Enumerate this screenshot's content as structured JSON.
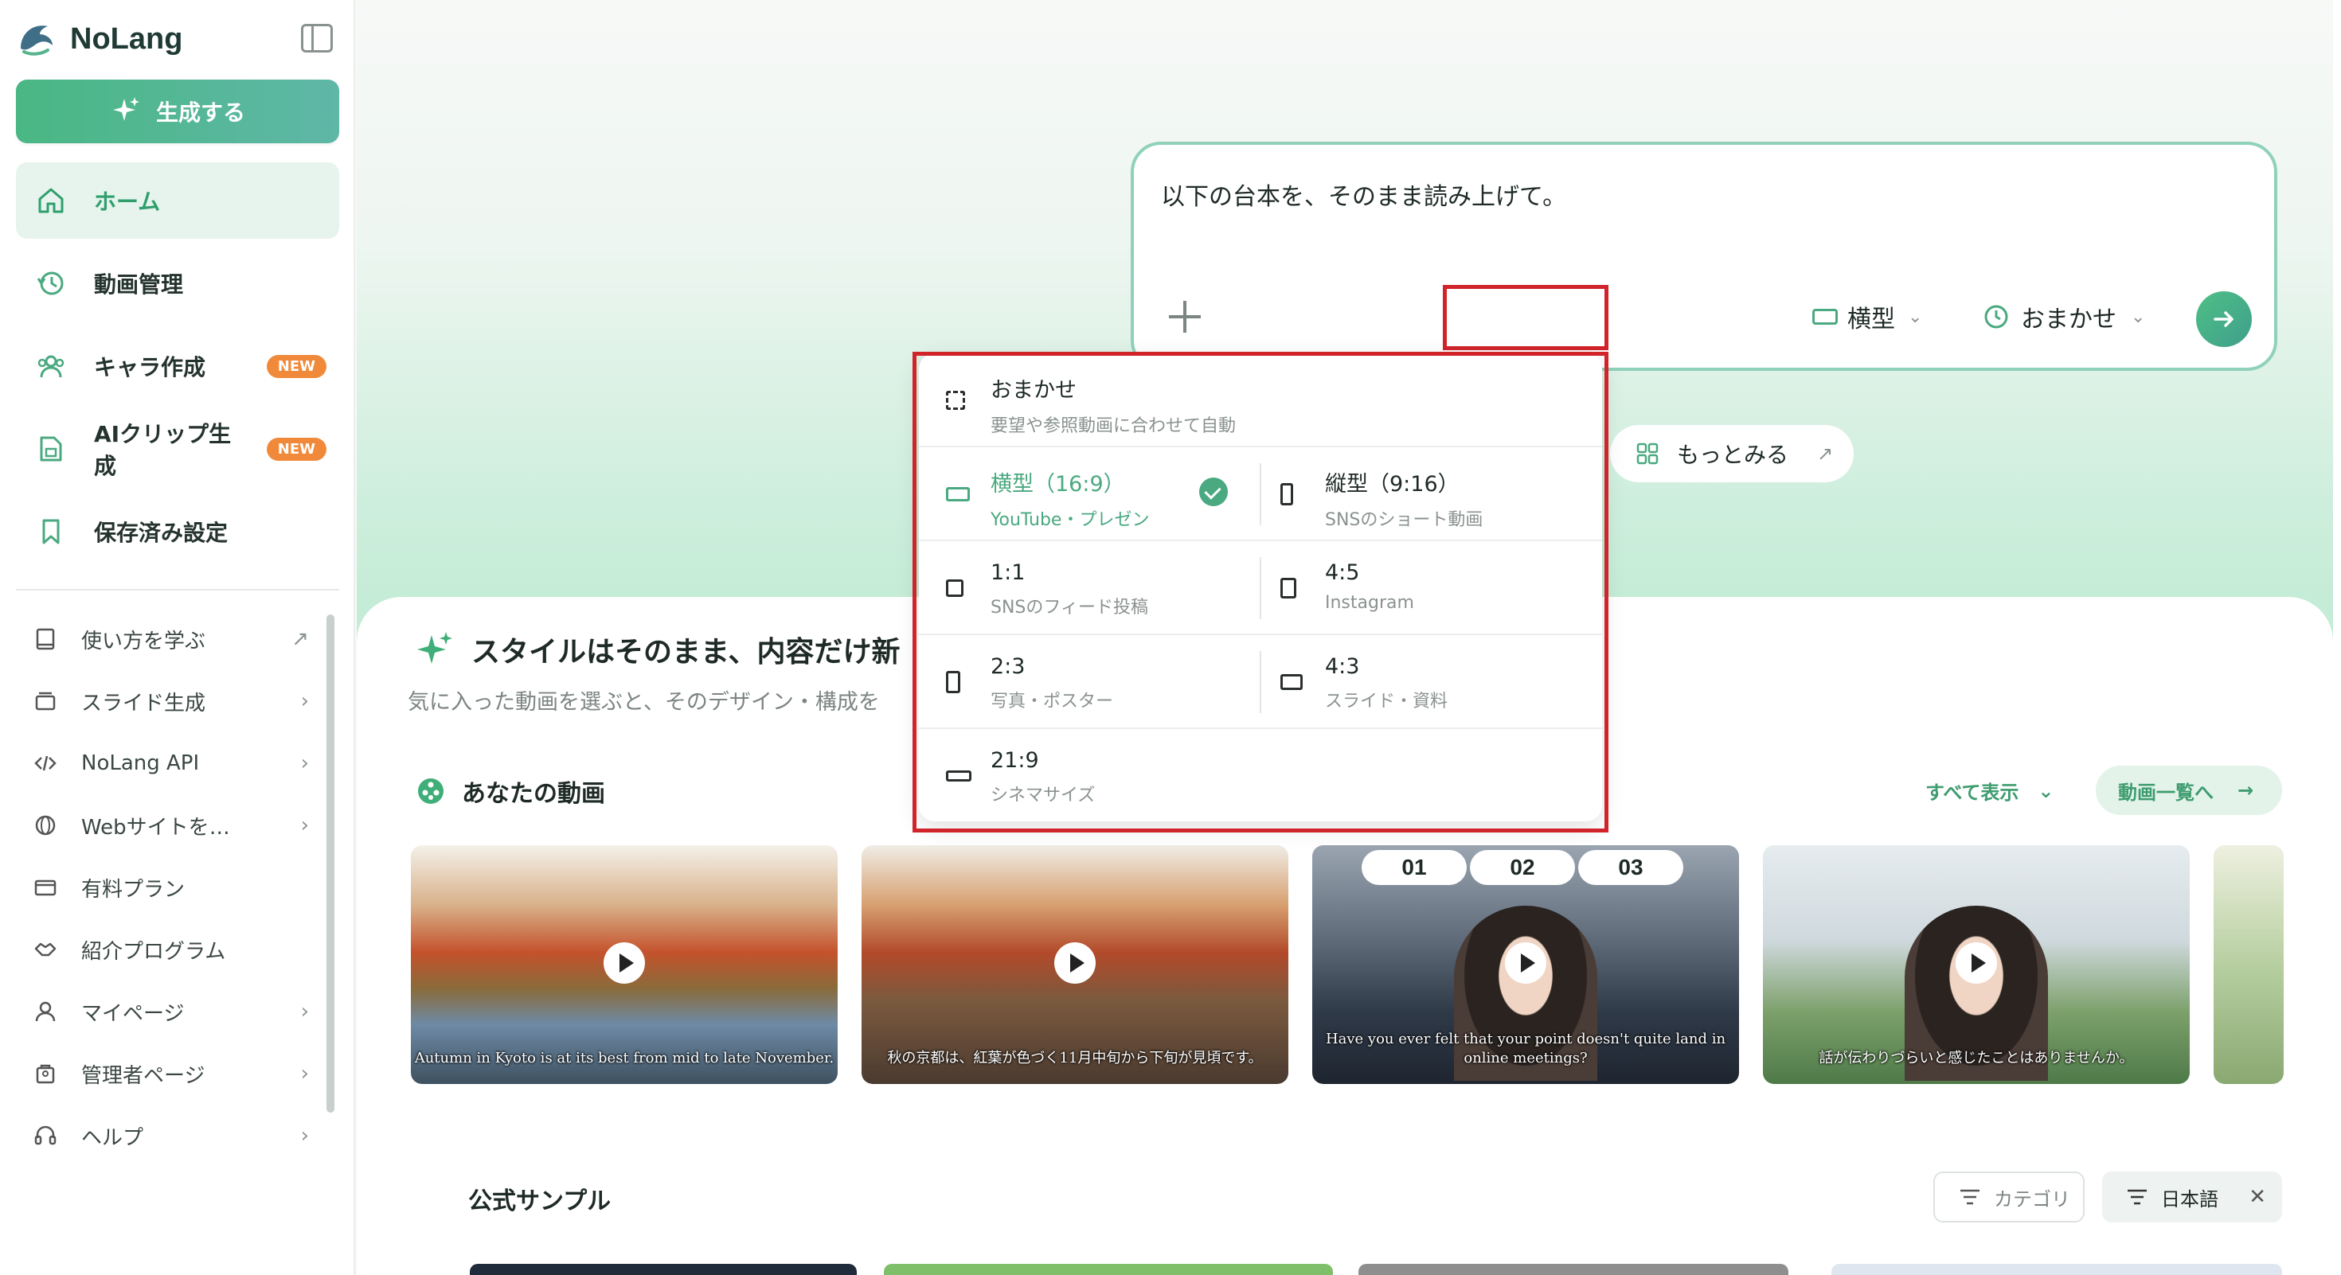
{
  "app": {
    "name": "NoLang"
  },
  "sidebar": {
    "generate_label": "生成する",
    "nav": [
      {
        "label": "ホーム",
        "icon": "home-icon",
        "active": true
      },
      {
        "label": "動画管理",
        "icon": "history-icon"
      },
      {
        "label": "キャラ作成",
        "icon": "users-icon",
        "badge": "NEW"
      },
      {
        "label": "AIクリップ生成",
        "icon": "clip-icon",
        "badge": "NEW"
      },
      {
        "label": "保存済み設定",
        "icon": "bookmark-icon"
      }
    ],
    "sub_nav": [
      {
        "label": "使い方を学ぶ",
        "icon": "book-icon",
        "tail": "↗"
      },
      {
        "label": "スライド生成",
        "icon": "slides-icon",
        "tail": "›"
      },
      {
        "label": "NoLang API",
        "icon": "code-icon",
        "tail": "›"
      },
      {
        "label": "Webサイトを動画にする",
        "icon": "web-icon",
        "tail": "›"
      },
      {
        "label": "有料プラン",
        "icon": "card-icon",
        "tail": ""
      },
      {
        "label": "紹介プログラム",
        "icon": "handshake-icon",
        "tail": ""
      },
      {
        "label": "マイページ",
        "icon": "user-icon",
        "tail": "›"
      },
      {
        "label": "管理者ページ",
        "icon": "admin-icon",
        "tail": "›"
      },
      {
        "label": "ヘルプ",
        "icon": "headset-icon",
        "tail": "›"
      }
    ]
  },
  "prompt": {
    "text": "以下の台本を、そのまま読み上げて。",
    "ratio_label": "横型",
    "duration_label": "おまかせ"
  },
  "more_label": "もっとみる",
  "style_section": {
    "title": "スタイルはそのまま、内容だけ新",
    "subtitle": "気に入った動画を選ぶと、そのデザイン・構成を"
  },
  "videos": {
    "title": "あなたの動画",
    "show_all": "すべて表示",
    "list_button": "動画一覧へ",
    "items": [
      {
        "caption": "Autumn in Kyoto is at its best from mid to late November."
      },
      {
        "caption": "秋の京都は、紅葉が色づく11月中旬から下旬が見頃です。"
      },
      {
        "caption": "Have you ever felt that your point doesn't quite land in online meetings?",
        "steps": [
          "01",
          "02",
          "03"
        ]
      },
      {
        "caption": "話が伝わりづらいと感じたことはありませんか。"
      }
    ]
  },
  "samples": {
    "title": "公式サンプル",
    "category_label": "カテゴリ",
    "language_label": "日本語"
  },
  "ratio_dropdown": {
    "auto": {
      "label": "おまかせ",
      "sub": "要望や参照動画に合わせて自動"
    },
    "options": [
      {
        "label": "横型（16:9）",
        "sub": "YouTube・プレゼン",
        "selected": true
      },
      {
        "label": "縦型（9:16）",
        "sub": "SNSのショート動画"
      },
      {
        "label": "1:1",
        "sub": "SNSのフィード投稿"
      },
      {
        "label": "4:5",
        "sub": "Instagram"
      },
      {
        "label": "2:3",
        "sub": "写真・ポスター"
      },
      {
        "label": "4:3",
        "sub": "スライド・資料"
      },
      {
        "label": "21:9",
        "sub": "シネマサイズ"
      }
    ]
  },
  "colors": {
    "accent": "#4aa980",
    "highlight_red": "#d1232a",
    "badge_orange": "#f08a3a"
  }
}
